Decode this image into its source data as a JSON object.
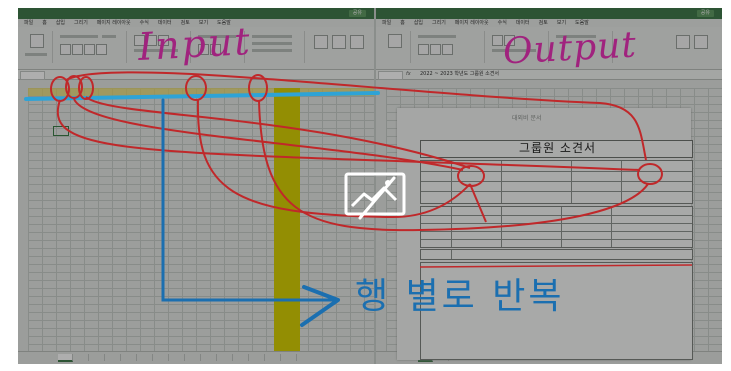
{
  "left_window": {
    "menu": [
      "파일",
      "홈",
      "삽입",
      "그리기",
      "페이지 레이아웃",
      "수식",
      "데이터",
      "검토",
      "보기",
      "도움말"
    ],
    "shared_label": "공유"
  },
  "right_window": {
    "menu": [
      "파일",
      "홈",
      "삽입",
      "그리기",
      "페이지 레이아웃",
      "수식",
      "데이터",
      "검토",
      "보기",
      "도움말"
    ],
    "shared_label": "공유",
    "formula_text": "2022 ~ 2023 학년도 그룹원 소견서",
    "document": {
      "header_label": "대외비 문서",
      "title": "그룹원 소견서"
    }
  },
  "annotations": {
    "input_label": "Input",
    "output_label": "Output",
    "repeat_label": "행 별로 반복"
  },
  "colors": {
    "annotation_red": "#c0282a",
    "annotation_blue": "#1b6fb0",
    "annotation_magenta": "#a0237e",
    "highlight_yellow": "#d7d000",
    "excel_green": "#3f7a4a"
  },
  "icons": {
    "center_overlay": "broken-image-icon"
  }
}
